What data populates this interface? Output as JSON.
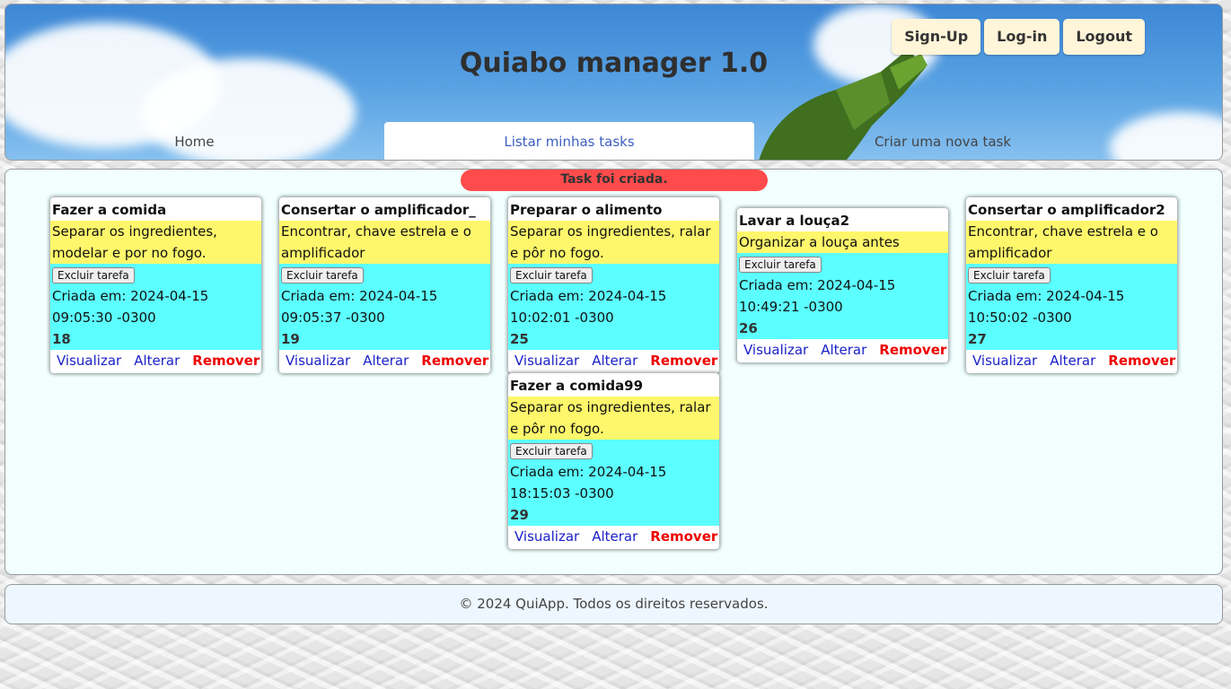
{
  "header": {
    "title": "Quiabo manager 1.0",
    "auth": {
      "signup": "Sign-Up",
      "login": "Log-in",
      "logout": "Logout"
    },
    "nav": [
      "Home",
      "Listar minhas tasks",
      "Criar uma nova task"
    ],
    "active_nav": "Listar minhas tasks"
  },
  "flash": "Task foi criada.",
  "labels": {
    "delete_button": "Excluir tarefa",
    "created_prefix": "Criada em: ",
    "view": "Visualizar",
    "edit": "Alterar",
    "remove": "Remover"
  },
  "tasks": [
    {
      "title": "Fazer a comida",
      "description": "Separar os ingredientes, modelar e por no fogo.",
      "created": "2024-04-15 09:05:30 -0300",
      "id": "18"
    },
    {
      "title": "Consertar o amplificador_",
      "description": "Encontrar, chave estrela e o amplificador",
      "created": "2024-04-15 09:05:37 -0300",
      "id": "19"
    },
    {
      "title": "Preparar o alimento",
      "description": "Separar os ingredientes, ralar e pôr no fogo.",
      "created": "2024-04-15 10:02:01 -0300",
      "id": "25"
    },
    {
      "title": "Lavar a louça2",
      "description": "Organizar a louça antes",
      "created": "2024-04-15 10:49:21 -0300",
      "id": "26"
    },
    {
      "title": "Consertar o amplificador2",
      "description": "Encontrar, chave estrela e o amplificador",
      "created": "2024-04-15 10:50:02 -0300",
      "id": "27"
    },
    {
      "title": "Fazer a comida99",
      "description": "Separar os ingredientes, ralar e pôr no fogo.",
      "created": "2024-04-15 18:15:03 -0300",
      "id": "29"
    }
  ],
  "footer": "© 2024 QuiApp. Todos os direitos reservados.",
  "colors": {
    "description_bg": "#fff76b",
    "meta_bg": "#5cffff",
    "flash_bg": "#ff4b4b",
    "link": "#1b21c8",
    "remove": "#ee0000"
  }
}
